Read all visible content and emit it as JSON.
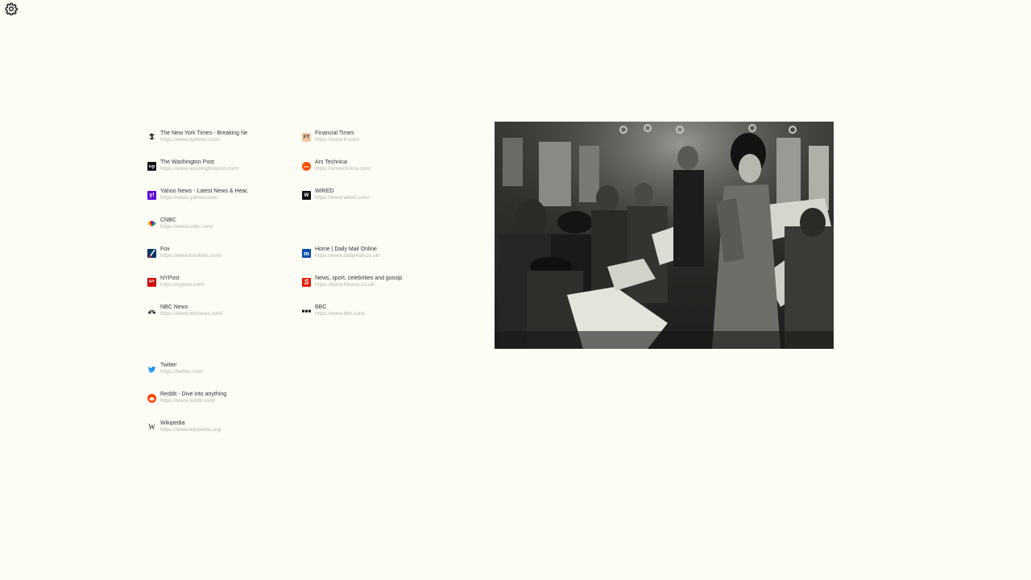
{
  "settings": {
    "icon": "gear-icon"
  },
  "columns": [
    {
      "links": [
        {
          "title": "The New York Times - Breaking News",
          "url": "https://www.nytimes.com/",
          "icon": "nyt-icon"
        },
        {
          "title": "The Washington Post",
          "url": "https://www.washingtonpost.com/",
          "icon": "wapo-icon"
        },
        {
          "title": "Yahoo News - Latest News & Headlines",
          "url": "https://news.yahoo.com/",
          "icon": "yahoo-icon"
        },
        {
          "title": "CNBC",
          "url": "https://www.cnbc.com/",
          "icon": "cnbc-icon"
        },
        {
          "title": "Fox",
          "url": "https://www.foxnews.com/",
          "icon": "fox-icon"
        },
        {
          "title": "NYPost",
          "url": "https://nypost.com/",
          "icon": "nypost-icon"
        },
        {
          "title": "NBC News",
          "url": "https://www.nbcnews.com/",
          "icon": "nbc-icon"
        }
      ]
    },
    {
      "links": [
        {
          "title": "Financial Times",
          "url": "https://www.ft.com/",
          "icon": "ft-icon"
        },
        {
          "title": "Ars Technica",
          "url": "https://arstechnica.com/",
          "icon": "ars-icon"
        },
        {
          "title": "WIRED",
          "url": "https://www.wired.com/",
          "icon": "wired-icon"
        },
        {
          "title": "",
          "url": "",
          "icon": ""
        },
        {
          "title": "Home | Daily Mail Online",
          "url": "https://www.dailymail.co.uk/",
          "icon": "dailymail-icon"
        },
        {
          "title": "News, sport, celebrities and gossip",
          "url": "https://www.thesun.co.uk/",
          "icon": "sun-icon"
        },
        {
          "title": "BBC",
          "url": "https://www.bbc.com/",
          "icon": "bbc-icon"
        }
      ]
    },
    {
      "links": [
        {
          "title": "Twitter",
          "url": "https://twitter.com/",
          "icon": "twitter-icon"
        },
        {
          "title": "Reddit - Dive into anything",
          "url": "https://www.reddit.com/",
          "icon": "reddit-icon"
        },
        {
          "title": "Wikipedia",
          "url": "https://www.wikipedia.org/",
          "icon": "wikipedia-icon"
        }
      ]
    }
  ],
  "photo": {
    "subject": "subway-newspaper-readers-photo"
  }
}
